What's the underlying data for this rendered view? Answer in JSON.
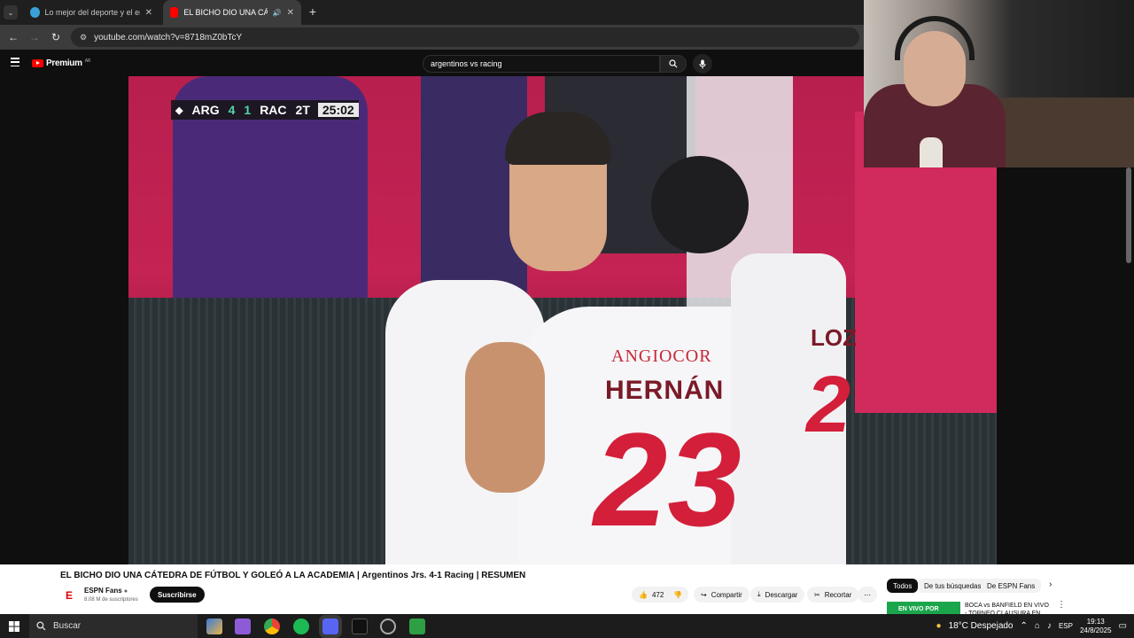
{
  "browser": {
    "tabs": [
      {
        "label": "Lo mejor del deporte y el entre",
        "active": false
      },
      {
        "label": "EL BICHO DIO UNA CÁTEDR",
        "active": true
      }
    ],
    "url": "youtube.com/watch?v=8718mZ0bTcY"
  },
  "youtube": {
    "logo_text": "Premium",
    "logo_badge": "AR",
    "search_value": "argentinos vs racing"
  },
  "scoreboard": {
    "home": "ARG",
    "home_score": "4",
    "away_score": "1",
    "away": "RAC",
    "period": "2T",
    "clock": "25:02"
  },
  "jersey": {
    "name": "HERNÁN",
    "sponsor": "ANGIOCOR",
    "number": "23",
    "name2": "LOZ",
    "number2": "2"
  },
  "video": {
    "title": "EL BICHO DIO UNA CÁTEDRA DE FÚTBOL Y GOLEÓ A LA ACADEMIA | Argentinos Jrs. 4-1 Racing | RESUMEN",
    "channel": "ESPN Fans",
    "subscribers": "8.08 M de suscriptores",
    "subscribe_label": "Suscribirse",
    "likes": "472",
    "share_label": "Compartir",
    "download_label": "Descargar",
    "clip_label": "Recortar"
  },
  "chips": [
    "Todos",
    "De tus búsquedas",
    "De ESPN Fans"
  ],
  "recommendation": {
    "thumb_text": "EN VIVO POR",
    "title": "BOCA vs BANFIELD EN VIVO - TORNEO CLAUSURA EN VIVO"
  },
  "taskbar": {
    "search_placeholder": "Buscar",
    "weather": "18°C  Despejado",
    "lang": "ESP",
    "time": "19:13",
    "date": "24/8/2025"
  },
  "colors": {
    "youtube_red": "#ff0000",
    "score_green": "#52d6a8",
    "jersey_red": "#d41f3a",
    "crowd_pink": "#c0204f"
  }
}
